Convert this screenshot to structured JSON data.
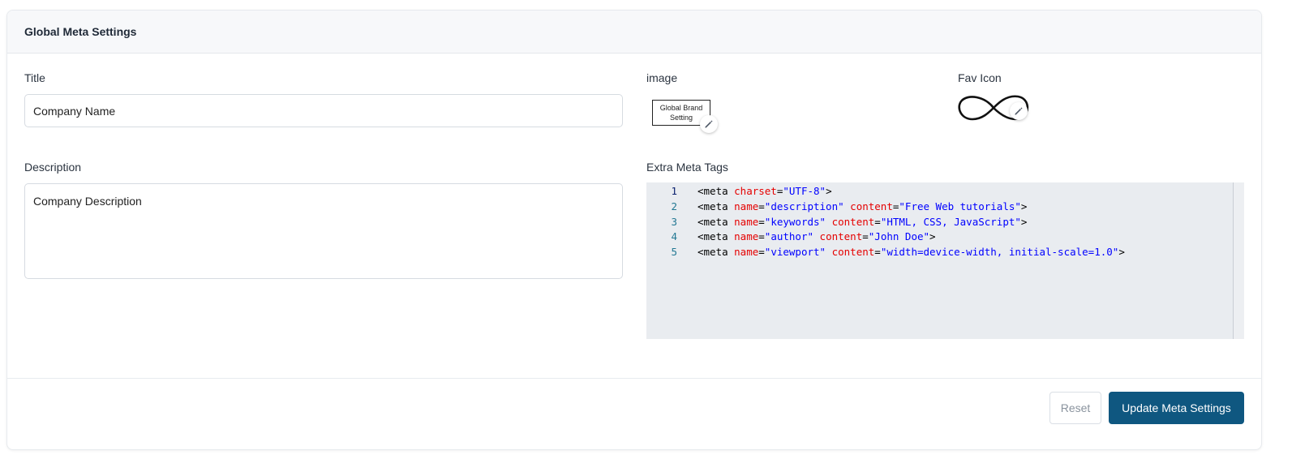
{
  "card": {
    "title": "Global Meta Settings"
  },
  "title_field": {
    "label": "Title",
    "value": "Company Name"
  },
  "description_field": {
    "label": "Description",
    "value": "Company Description"
  },
  "image_field": {
    "label": "image",
    "preview_text": "Global Brand Setting",
    "edit_icon": "pencil-icon"
  },
  "favicon_field": {
    "label": "Fav Icon",
    "icon": "infinity-icon",
    "edit_icon": "pencil-icon"
  },
  "extra_meta": {
    "label": "Extra Meta Tags",
    "line_numbers": [
      "1",
      "2",
      "3",
      "4",
      "5"
    ],
    "lines": [
      [
        [
          "t-tag",
          "<meta "
        ],
        [
          "t-attr",
          "charset"
        ],
        [
          "t-tag",
          "="
        ],
        [
          "t-val",
          "\"UTF-8\""
        ],
        [
          "t-tag",
          ">"
        ]
      ],
      [
        [
          "t-tag",
          "<meta "
        ],
        [
          "t-attr",
          "name"
        ],
        [
          "t-tag",
          "="
        ],
        [
          "t-val",
          "\"description\""
        ],
        [
          "t-tag",
          " "
        ],
        [
          "t-attr",
          "content"
        ],
        [
          "t-tag",
          "="
        ],
        [
          "t-val",
          "\"Free Web tutorials\""
        ],
        [
          "t-tag",
          ">"
        ]
      ],
      [
        [
          "t-tag",
          "<meta "
        ],
        [
          "t-attr",
          "name"
        ],
        [
          "t-tag",
          "="
        ],
        [
          "t-val",
          "\"keywords\""
        ],
        [
          "t-tag",
          " "
        ],
        [
          "t-attr",
          "content"
        ],
        [
          "t-tag",
          "="
        ],
        [
          "t-val",
          "\"HTML, CSS, JavaScript\""
        ],
        [
          "t-tag",
          ">"
        ]
      ],
      [
        [
          "t-tag",
          "<meta "
        ],
        [
          "t-attr",
          "name"
        ],
        [
          "t-tag",
          "="
        ],
        [
          "t-val",
          "\"author\""
        ],
        [
          "t-tag",
          " "
        ],
        [
          "t-attr",
          "content"
        ],
        [
          "t-tag",
          "="
        ],
        [
          "t-val",
          "\"John Doe\""
        ],
        [
          "t-tag",
          ">"
        ]
      ],
      [
        [
          "t-tag",
          "<meta "
        ],
        [
          "t-attr",
          "name"
        ],
        [
          "t-tag",
          "="
        ],
        [
          "t-val",
          "\"viewport\""
        ],
        [
          "t-tag",
          " "
        ],
        [
          "t-attr",
          "content"
        ],
        [
          "t-tag",
          "="
        ],
        [
          "t-val",
          "\"width=device-width, initial-scale=1.0\""
        ],
        [
          "t-tag",
          ">"
        ]
      ]
    ]
  },
  "actions": {
    "reset_label": "Reset",
    "update_label": "Update Meta Settings"
  },
  "colors": {
    "primary": "#0f5780",
    "editor_bg": "#e9ecf0",
    "attr": "#e50000",
    "value": "#0000ff",
    "line_number": "#237893"
  }
}
